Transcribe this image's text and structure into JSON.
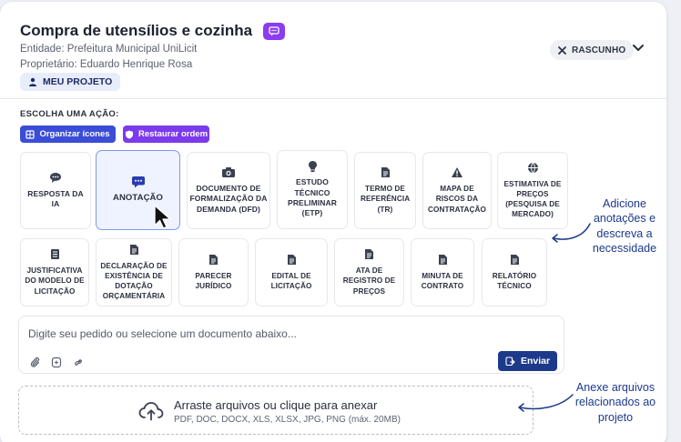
{
  "header": {
    "title": "Compra de utensílios e cozinha",
    "entity": "Entidade: Prefeitura Municipal UniLicit",
    "owner": "Proprietário: Eduardo Henrique Rosa",
    "my_project_label": "MEU PROJETO",
    "status_label": "RASCUNHO"
  },
  "actions": {
    "choose_label": "ESCOLHA UMA AÇÃO:",
    "organize_label": "Organizar ícones",
    "restore_label": "Restaurar ordem"
  },
  "tiles_row1": [
    {
      "label": "RESPOSTA DA IA",
      "icon": "chat-dots-icon"
    },
    {
      "label": "ANOTAÇÃO",
      "icon": "note-chat-icon"
    },
    {
      "label": "DOCUMENTO DE FORMALIZAÇÃO DA DEMANDA (DFD)",
      "icon": "camera-doc-icon"
    },
    {
      "label": "ESTUDO TÉCNICO PRELIMINAR (ETP)",
      "icon": "lightbulb-icon"
    },
    {
      "label": "TERMO DE REFERÊNCIA (TR)",
      "icon": "document-icon"
    },
    {
      "label": "MAPA DE RISCOS DA CONTRATAÇÃO",
      "icon": "warning-icon"
    },
    {
      "label": "ESTIMATIVA DE PREÇOS (PESQUISA DE MERCADO)",
      "icon": "globe-icon"
    }
  ],
  "tiles_row2": [
    {
      "label": "JUSTIFICATIVA DO MODELO DE LICITAÇÃO",
      "icon": "list-doc-icon"
    },
    {
      "label": "DECLARAÇÃO DE EXISTÊNCIA DE DOTAÇÃO ORÇAMENTÁRIA",
      "icon": "document-icon"
    },
    {
      "label": "PARECER JURÍDICO",
      "icon": "document-icon"
    },
    {
      "label": "EDITAL DE LICITAÇÃO",
      "icon": "document-icon"
    },
    {
      "label": "ATA DE REGISTRO DE PREÇOS",
      "icon": "document-icon"
    },
    {
      "label": "MINUTA DE CONTRATO",
      "icon": "document-icon"
    },
    {
      "label": "RELATÓRIO TÉCNICO",
      "icon": "document-icon"
    }
  ],
  "composer": {
    "placeholder": "Digite seu pedido ou selecione um documento abaixo...",
    "send_label": "Enviar"
  },
  "upload": {
    "title": "Arraste arquivos ou clique para anexar",
    "subtitle": "PDF, DOC, DOCX, XLS, XLSX, JPG, PNG (máx. 20MB)"
  },
  "annotations": {
    "notes_hint": "Adicione anotações e descreva a necessidade",
    "attach_hint": "Anexe arquivos relacionados ao projeto"
  },
  "colors": {
    "primary": "#3b4dd6",
    "purple": "#7c3aed",
    "navy": "#1d3a8a"
  }
}
